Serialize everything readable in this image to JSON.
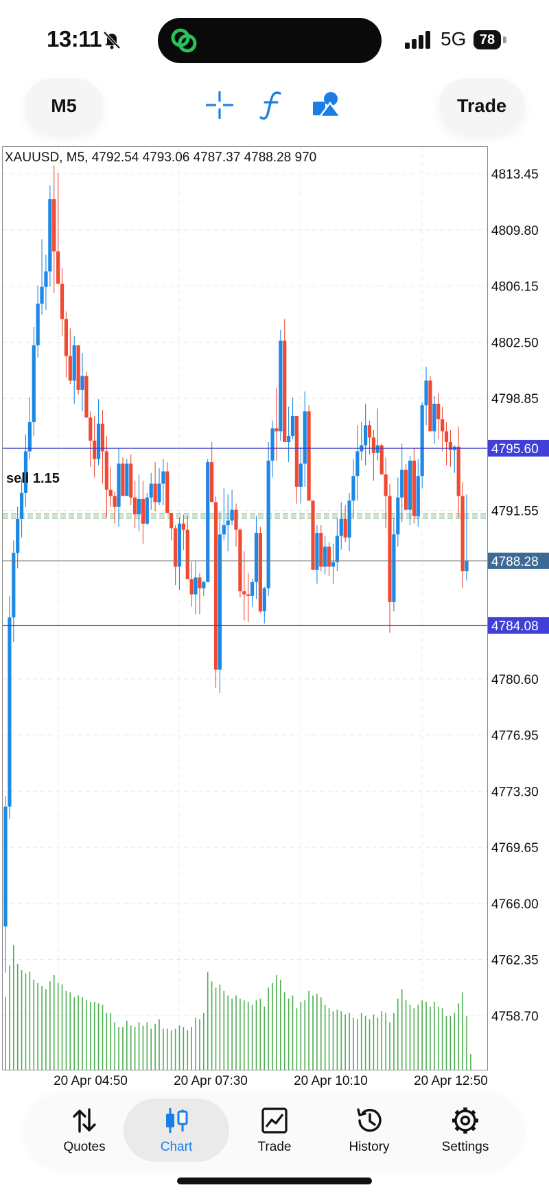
{
  "status_bar": {
    "time": "13:11",
    "network": "5G",
    "battery": "78"
  },
  "toolbar": {
    "timeframe": "M5",
    "trade_label": "Trade",
    "icons": [
      "crosshair-icon",
      "function-icon",
      "objects-icon"
    ]
  },
  "chart": {
    "header": "XAUUSD, M5, 4792.54 4793.06 4787.37 4788.28 970",
    "order_label": "sell 1.15",
    "price_ticks": [
      "4813.45",
      "4809.80",
      "4806.15",
      "4802.50",
      "4798.85",
      "4791.55",
      "4780.60",
      "4776.95",
      "4773.30",
      "4769.65",
      "4766.00",
      "4762.35",
      "4758.70"
    ],
    "line_labels": [
      "4795.60",
      "4788.28",
      "4784.08"
    ],
    "time_labels": [
      "20 Apr 04:50",
      "20 Apr 07:30",
      "20 Apr 10:10",
      "20 Apr 12:50"
    ],
    "colors": {
      "bull": "#1e88e5",
      "bear": "#ef4a32",
      "level_line": "#3838c8",
      "bid_line": "#3d6a95",
      "volume": "#4caf50"
    }
  },
  "chart_data": {
    "type": "candlestick",
    "symbol": "XAUUSD",
    "timeframe": "M5",
    "ylim": [
      4755.9,
      4815.2
    ],
    "last": {
      "open": 4792.54,
      "high": 4793.06,
      "low": 4787.37,
      "close": 4788.28,
      "volume": 970
    },
    "horizontal_lines": [
      4795.6,
      4788.28,
      4784.08
    ],
    "order_level": 4791.2,
    "x_tick_labels": [
      "20 Apr 04:50",
      "20 Apr 07:30",
      "20 Apr 10:10",
      "20 Apr 12:50"
    ],
    "candles_ohlc": [
      [
        4764.5,
        4773.0,
        4761.5,
        4772.3
      ],
      [
        4772.3,
        4786.0,
        4771.5,
        4784.6
      ],
      [
        4784.6,
        4789.6,
        4783.0,
        4788.8
      ],
      [
        4788.8,
        4791.8,
        4787.8,
        4791.0
      ],
      [
        4791.0,
        4793.6,
        4789.8,
        4792.7
      ],
      [
        4792.7,
        4796.5,
        4791.8,
        4795.4
      ],
      [
        4795.4,
        4798.9,
        4794.9,
        4797.3
      ],
      [
        4797.3,
        4803.5,
        4796.4,
        4802.3
      ],
      [
        4802.3,
        4806.2,
        4801.5,
        4805.0
      ],
      [
        4805.0,
        4809.2,
        4804.3,
        4806.1
      ],
      [
        4806.1,
        4808.2,
        4804.6,
        4807.1
      ],
      [
        4807.1,
        4812.7,
        4806.1,
        4811.8
      ],
      [
        4811.8,
        4814.0,
        4805.7,
        4808.4
      ],
      [
        4808.4,
        4813.5,
        4806.4,
        4806.3
      ],
      [
        4806.3,
        4807.3,
        4802.9,
        4804.0
      ],
      [
        4804.0,
        4804.5,
        4800.2,
        4801.6
      ],
      [
        4801.6,
        4803.4,
        4799.8,
        4800.0
      ],
      [
        4800.0,
        4802.9,
        4798.5,
        4802.3
      ],
      [
        4802.3,
        4802.3,
        4799.1,
        4799.4
      ],
      [
        4799.4,
        4801.8,
        4798.0,
        4800.3
      ],
      [
        4800.3,
        4800.6,
        4797.9,
        4797.6
      ],
      [
        4797.6,
        4798.0,
        4794.4,
        4796.1
      ],
      [
        4796.1,
        4797.7,
        4793.7,
        4794.9
      ],
      [
        4794.9,
        4798.8,
        4794.5,
        4797.2
      ],
      [
        4797.2,
        4798.1,
        4793.3,
        4795.4
      ],
      [
        4795.4,
        4796.4,
        4791.1,
        4792.9
      ],
      [
        4792.9,
        4794.4,
        4791.8,
        4792.5
      ],
      [
        4792.5,
        4792.8,
        4790.7,
        4791.8
      ],
      [
        4791.8,
        4795.6,
        4790.5,
        4794.6
      ],
      [
        4794.6,
        4795.0,
        4792.9,
        4792.5
      ],
      [
        4792.5,
        4794.9,
        4792.7,
        4794.6
      ],
      [
        4794.6,
        4795.2,
        4791.9,
        4792.4
      ],
      [
        4792.4,
        4793.5,
        4790.4,
        4791.3
      ],
      [
        4791.3,
        4793.9,
        4790.2,
        4792.3
      ],
      [
        4792.3,
        4793.5,
        4789.4,
        4790.7
      ],
      [
        4790.7,
        4792.7,
        4790.6,
        4792.4
      ],
      [
        4792.4,
        4794.0,
        4791.6,
        4793.3
      ],
      [
        4793.3,
        4794.7,
        4791.5,
        4792.1
      ],
      [
        4792.1,
        4794.3,
        4791.9,
        4793.3
      ],
      [
        4793.3,
        4794.9,
        4791.9,
        4794.1
      ],
      [
        4794.1,
        4794.7,
        4792.4,
        4791.4
      ],
      [
        4791.4,
        4791.4,
        4789.6,
        4790.4
      ],
      [
        4790.4,
        4790.6,
        4786.7,
        4787.9
      ],
      [
        4787.9,
        4791.1,
        4786.4,
        4790.7
      ],
      [
        4790.7,
        4791.3,
        4789.0,
        4790.3
      ],
      [
        4790.3,
        4791.2,
        4787.2,
        4787.1
      ],
      [
        4787.1,
        4788.2,
        4785.3,
        4786.1
      ],
      [
        4786.1,
        4788.3,
        4784.8,
        4787.2
      ],
      [
        4787.2,
        4787.5,
        4784.8,
        4786.5
      ],
      [
        4786.5,
        4787.0,
        4786.0,
        4786.9
      ],
      [
        4786.9,
        4794.9,
        4787.3,
        4794.7
      ],
      [
        4794.7,
        4796.0,
        4793.0,
        4792.1
      ],
      [
        4792.1,
        4792.5,
        4780.0,
        4781.2
      ],
      [
        4781.2,
        4791.5,
        4779.7,
        4790.0
      ],
      [
        4790.0,
        4793.0,
        4789.6,
        4790.6
      ],
      [
        4790.6,
        4792.6,
        4788.9,
        4790.9
      ],
      [
        4790.9,
        4792.9,
        4790.6,
        4791.6
      ],
      [
        4791.6,
        4792.0,
        4789.2,
        4790.3
      ],
      [
        4790.3,
        4790.4,
        4785.9,
        4786.3
      ],
      [
        4786.3,
        4788.9,
        4784.4,
        4786.1
      ],
      [
        4786.1,
        4787.5,
        4784.3,
        4786.0
      ],
      [
        4786.0,
        4787.1,
        4785.3,
        4786.9
      ],
      [
        4786.9,
        4791.2,
        4785.8,
        4790.1
      ],
      [
        4790.1,
        4790.5,
        4784.9,
        4785.0
      ],
      [
        4785.0,
        4786.6,
        4784.2,
        4786.5
      ],
      [
        4786.5,
        4796.0,
        4786.0,
        4794.8
      ],
      [
        4794.8,
        4797.4,
        4793.7,
        4796.9
      ],
      [
        4796.9,
        4799.5,
        4794.8,
        4796.7
      ],
      [
        4796.7,
        4803.3,
        4796.1,
        4802.6
      ],
      [
        4802.6,
        4804.0,
        4797.2,
        4796.0
      ],
      [
        4796.0,
        4798.3,
        4794.7,
        4796.4
      ],
      [
        4796.4,
        4798.9,
        4796.2,
        4797.7
      ],
      [
        4797.7,
        4797.6,
        4792.0,
        4793.1
      ],
      [
        4793.1,
        4795.7,
        4792.0,
        4794.6
      ],
      [
        4794.6,
        4799.3,
        4793.1,
        4798.0
      ],
      [
        4798.0,
        4798.4,
        4792.9,
        4792.2
      ],
      [
        4792.2,
        4792.2,
        4787.9,
        4787.7
      ],
      [
        4787.7,
        4790.6,
        4786.8,
        4790.1
      ],
      [
        4790.1,
        4790.6,
        4787.6,
        4787.9
      ],
      [
        4787.9,
        4789.9,
        4787.4,
        4789.2
      ],
      [
        4789.2,
        4789.5,
        4787.3,
        4787.9
      ],
      [
        4787.9,
        4789.4,
        4786.8,
        4788.2
      ],
      [
        4788.2,
        4791.1,
        4787.6,
        4789.9
      ],
      [
        4789.9,
        4792.1,
        4789.0,
        4791.0
      ],
      [
        4791.0,
        4791.9,
        4789.5,
        4789.8
      ],
      [
        4789.8,
        4792.7,
        4788.9,
        4792.2
      ],
      [
        4792.2,
        4794.9,
        4791.1,
        4793.8
      ],
      [
        4793.8,
        4797.1,
        4792.2,
        4795.4
      ],
      [
        4795.4,
        4797.3,
        4794.8,
        4795.8
      ],
      [
        4795.8,
        4798.5,
        4794.5,
        4797.1
      ],
      [
        4797.1,
        4797.4,
        4795.2,
        4796.3
      ],
      [
        4796.3,
        4796.8,
        4793.5,
        4795.3
      ],
      [
        4795.3,
        4798.2,
        4794.8,
        4795.8
      ],
      [
        4795.8,
        4795.9,
        4794.2,
        4793.9
      ],
      [
        4793.9,
        4795.0,
        4790.4,
        4792.5
      ],
      [
        4792.5,
        4793.3,
        4783.6,
        4785.6
      ],
      [
        4785.6,
        4791.1,
        4785.0,
        4790.0
      ],
      [
        4790.0,
        4793.7,
        4789.2,
        4792.4
      ],
      [
        4792.4,
        4795.9,
        4790.8,
        4794.2
      ],
      [
        4794.2,
        4794.6,
        4791.7,
        4791.6
      ],
      [
        4791.6,
        4795.1,
        4790.6,
        4794.8
      ],
      [
        4794.8,
        4795.6,
        4790.7,
        4791.2
      ],
      [
        4791.2,
        4794.9,
        4790.5,
        4793.8
      ],
      [
        4793.8,
        4798.6,
        4793.0,
        4798.4
      ],
      [
        4798.4,
        4800.9,
        4797.1,
        4800.0
      ],
      [
        4800.0,
        4800.3,
        4797.3,
        4796.7
      ],
      [
        4796.7,
        4799.0,
        4795.9,
        4798.5
      ],
      [
        4798.5,
        4799.2,
        4796.2,
        4797.5
      ],
      [
        4797.5,
        4798.3,
        4795.4,
        4796.7
      ],
      [
        4796.7,
        4797.3,
        4794.5,
        4796.0
      ],
      [
        4796.0,
        4796.8,
        4794.4,
        4795.5
      ],
      [
        4795.5,
        4795.8,
        4794.0,
        4795.7
      ],
      [
        4795.7,
        4797.0,
        4791.1,
        4792.5
      ],
      [
        4792.5,
        4793.4,
        4786.5,
        4787.6
      ],
      [
        4787.6,
        4792.6,
        4787.0,
        4788.3
      ]
    ],
    "volume_relative": [
      0.46,
      0.66,
      0.79,
      0.67,
      0.63,
      0.61,
      0.62,
      0.57,
      0.55,
      0.53,
      0.51,
      0.56,
      0.6,
      0.55,
      0.54,
      0.5,
      0.49,
      0.46,
      0.47,
      0.46,
      0.44,
      0.43,
      0.43,
      0.42,
      0.41,
      0.36,
      0.36,
      0.3,
      0.27,
      0.27,
      0.31,
      0.28,
      0.27,
      0.3,
      0.28,
      0.3,
      0.26,
      0.29,
      0.32,
      0.26,
      0.26,
      0.25,
      0.26,
      0.28,
      0.27,
      0.25,
      0.27,
      0.33,
      0.32,
      0.36,
      0.62,
      0.56,
      0.52,
      0.54,
      0.5,
      0.47,
      0.45,
      0.47,
      0.45,
      0.44,
      0.43,
      0.41,
      0.44,
      0.45,
      0.4,
      0.52,
      0.55,
      0.6,
      0.57,
      0.49,
      0.45,
      0.47,
      0.39,
      0.43,
      0.44,
      0.5,
      0.47,
      0.48,
      0.46,
      0.41,
      0.39,
      0.37,
      0.38,
      0.37,
      0.35,
      0.36,
      0.33,
      0.32,
      0.36,
      0.34,
      0.32,
      0.35,
      0.33,
      0.37,
      0.36,
      0.3,
      0.36,
      0.45,
      0.51,
      0.44,
      0.41,
      0.39,
      0.41,
      0.44,
      0.43,
      0.4,
      0.43,
      0.4,
      0.39,
      0.34,
      0.34,
      0.36,
      0.42,
      0.49,
      0.34,
      0.1
    ]
  },
  "tabs": [
    {
      "label": "Quotes",
      "icon": "quotes-arrows-icon"
    },
    {
      "label": "Chart",
      "icon": "candles-icon",
      "active": true
    },
    {
      "label": "Trade",
      "icon": "trade-chart-icon"
    },
    {
      "label": "History",
      "icon": "history-clock-icon"
    },
    {
      "label": "Settings",
      "icon": "settings-gear-icon"
    }
  ]
}
